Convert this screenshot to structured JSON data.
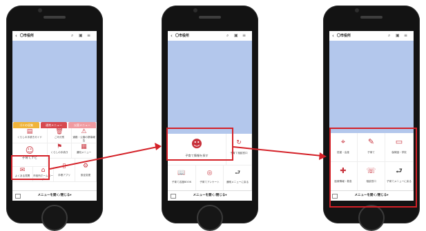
{
  "header": {
    "title": "〇市役所",
    "back_icon": "‹",
    "icons": [
      "search-icon",
      "calendar-icon",
      "menu-icon"
    ]
  },
  "bottom_bar": {
    "label": "メニューを開く/閉じる▾"
  },
  "colors": {
    "accent": "#d42027",
    "chat_bg": "#b3c7ec",
    "icon": "#c8323c"
  },
  "phone1": {
    "tabs": [
      "ゴミの収集",
      "通常メニュー",
      "災害メニュー"
    ],
    "items": [
      {
        "icon": "▤",
        "label": "くらしの手続きガイド"
      },
      {
        "icon": "🗑",
        "label": "ごみ分別"
      },
      {
        "icon": "⚠",
        "label": "道路・公園の損傷報告"
      },
      {
        "icon": "☺",
        "label": "子育てナビ"
      },
      {
        "icon": "⚑",
        "label": "くらしの手続き"
      },
      {
        "icon": "▦",
        "label": "通知メニュー"
      },
      {
        "icon": "✉",
        "label": "よくある質問"
      },
      {
        "icon": "⌂",
        "label": "市役所ホームページ"
      },
      {
        "icon": "▯",
        "label": "手帳アプリ"
      },
      {
        "icon": "⚙",
        "label": "設定変更"
      }
    ],
    "highlight_label": "子育てナビ"
  },
  "phone2": {
    "items": [
      {
        "icon": "☻",
        "label": "子育て情報を探す"
      },
      {
        "icon": "↻",
        "label": "子育て相談窓口"
      },
      {
        "icon": "📖",
        "label": "子育て応援BOOK"
      },
      {
        "icon": "◎",
        "label": "子育てアンケート"
      },
      {
        "icon": "⮐",
        "label": "通常メニューに戻る"
      }
    ]
  },
  "phone3": {
    "items": [
      {
        "icon": "⌖",
        "label": "妊娠・出産"
      },
      {
        "icon": "✎",
        "label": "子育て"
      },
      {
        "icon": "▭",
        "label": "保育園・学校"
      },
      {
        "icon": "✚",
        "label": "医療情報・救急"
      },
      {
        "icon": "☏",
        "label": "相談窓口"
      },
      {
        "icon": "⮐",
        "label": "子育てメニューに戻る"
      }
    ]
  }
}
